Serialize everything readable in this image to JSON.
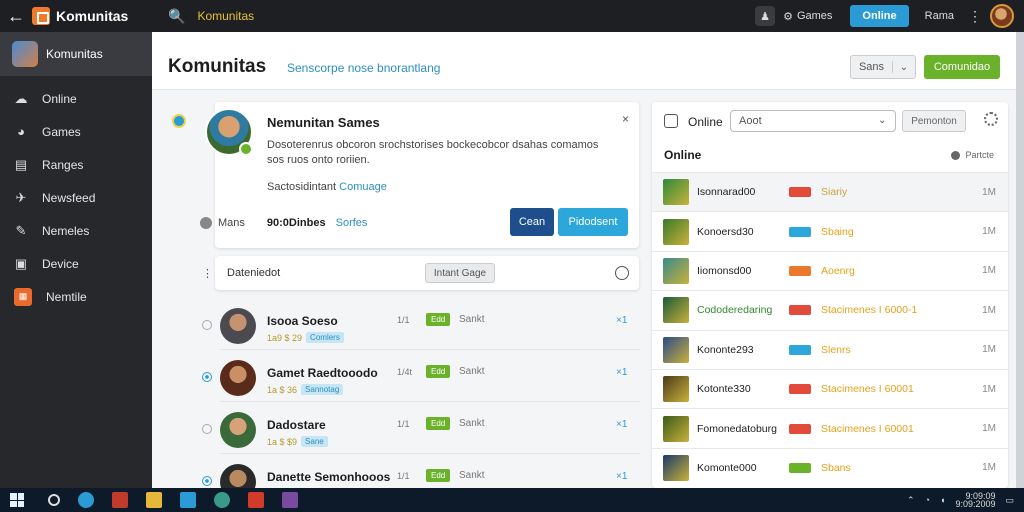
{
  "topbar": {
    "app_name": "Komunitas",
    "search_text": "Komunitas",
    "status_label": "Games",
    "primary_button": "Online",
    "user_name": "Rama",
    "menu_glyph": "⋮",
    "back_glyph": "←",
    "search_glyph": "🔍"
  },
  "sidebar": {
    "header": "Komunitas",
    "items": [
      {
        "label": "Online",
        "icon": "cloud-icon"
      },
      {
        "label": "Games",
        "icon": "controller-icon"
      },
      {
        "label": "Ranges",
        "icon": "chat-icon"
      },
      {
        "label": "Newsfeed",
        "icon": "bird-icon"
      },
      {
        "label": "Nemeles",
        "icon": "wrench-icon"
      },
      {
        "label": "Device",
        "icon": "bag-icon"
      },
      {
        "label": "Nemtile",
        "icon": "store-icon"
      }
    ]
  },
  "main": {
    "title": "Komunitas",
    "subtitle": "Senscorpe nose bnorantlang",
    "select_label": "Sans",
    "action_button": "Comunidao"
  },
  "profile_card": {
    "name": "Nemunitan Sames",
    "description": "Dosoterenrus obcoron srochstorises bockecobcor dsahas comamos sos ruos onto roriien.",
    "meta_label": "Sactosidintant",
    "meta_link": "Comuage",
    "close_glyph": "×",
    "btn_dark": "Cean",
    "btn_blue": "Pidodsent"
  },
  "stats": {
    "label": "Mans",
    "count": "90:0Dinbes",
    "link": "Sorfes"
  },
  "desc_card": {
    "label": "Dateniedot",
    "button": "Intant Gage"
  },
  "friends": [
    {
      "name": "Isooa Soeso",
      "sub": "1a9 $ 29",
      "chip": "Comlers",
      "time": "1/1",
      "tag": "Edd",
      "tag_label": "Sankt"
    },
    {
      "name": "Gamet Raedtooodo",
      "sub": "1a $ 36",
      "chip": "Sannotag",
      "time": "1/4t",
      "tag": "Edd",
      "tag_label": "Sankt"
    },
    {
      "name": "Dadostare",
      "sub": "1a $ $9",
      "chip": "Sane",
      "time": "1/1",
      "tag": "Edd",
      "tag_label": "Sankt"
    },
    {
      "name": "Danette Semonhooos",
      "sub": "",
      "chip": "",
      "time": "1/1",
      "tag": "Edd",
      "tag_label": "Sankt"
    }
  ],
  "friends_x": "×1",
  "right_panel": {
    "online_label": "Online",
    "input_value": "Aoot",
    "button": "Pemonton",
    "heading": "Online",
    "filter": "Partcte",
    "rows": [
      {
        "name": "Isonnarad00",
        "status": "Siariy",
        "count": "1M",
        "tag_color": "#e24a3a",
        "status_color": "#c9a23a",
        "thumb": "#2e8a3a",
        "highlight": true,
        "green": false
      },
      {
        "name": "Konoersd30",
        "status": "Sbaing",
        "count": "1M",
        "tag_color": "#2ba7dc",
        "status_color": "#e6a11a",
        "thumb": "#3a7a2a",
        "highlight": false,
        "green": false
      },
      {
        "name": "Iiomonsd00",
        "status": "Aoenrg",
        "count": "1M",
        "tag_color": "#ea7a2a",
        "status_color": "#e6a11a",
        "thumb": "#3a8a8a",
        "highlight": false,
        "green": false
      },
      {
        "name": "Cododeredaring",
        "status": "Stacimenes I 6000-1",
        "count": "1M",
        "tag_color": "#e24a3a",
        "status_color": "#e6a11a",
        "thumb": "#1a5a3a",
        "highlight": false,
        "green": true
      },
      {
        "name": "Kononte293",
        "status": "Slenrs",
        "count": "1M",
        "tag_color": "#2ba7dc",
        "status_color": "#e6a11a",
        "thumb": "#2a4a8a",
        "highlight": false,
        "green": false
      },
      {
        "name": "Kotonte330",
        "status": "Stacimenes I 60001",
        "count": "1M",
        "tag_color": "#e24a3a",
        "status_color": "#e6a11a",
        "thumb": "#4a3a1a",
        "highlight": false,
        "green": false
      },
      {
        "name": "Fomonedatoburg",
        "status": "Stacimenes I 60001",
        "count": "1M",
        "tag_color": "#e24a3a",
        "status_color": "#e6a11a",
        "thumb": "#3a5a1a",
        "highlight": false,
        "green": false
      },
      {
        "name": "Komonte000",
        "status": "Sbans",
        "count": "1M",
        "tag_color": "#6ab22a",
        "status_color": "#e6a11a",
        "thumb": "#1a3a6a",
        "highlight": false,
        "green": false
      }
    ]
  },
  "taskbar": {
    "clock_time": "9:09:09",
    "clock_date": "9:09:2009"
  },
  "colors": {
    "accent_blue": "#2b9bd6",
    "accent_green": "#6ab22a",
    "dark_blue": "#1e4f8c",
    "sidebar_bg": "#27282c",
    "topbar_bg": "#1e1f22"
  }
}
